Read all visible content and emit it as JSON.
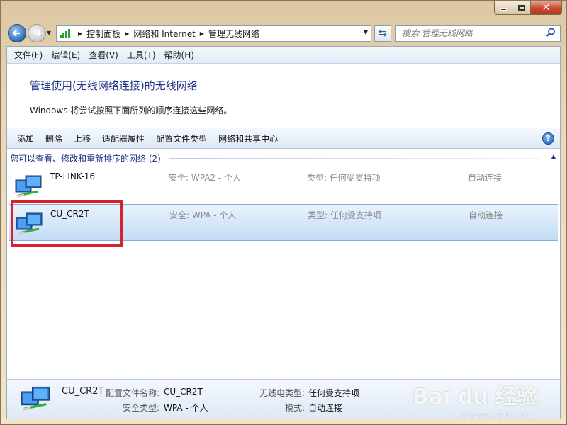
{
  "window": {
    "title": ""
  },
  "nav": {
    "breadcrumbs": [
      "控制面板",
      "网络和 Internet",
      "管理无线网络"
    ],
    "search_placeholder": "搜索 管理无线网络"
  },
  "menubar": [
    "文件(F)",
    "编辑(E)",
    "查看(V)",
    "工具(T)",
    "帮助(H)"
  ],
  "header": {
    "title": "管理使用(无线网络连接)的无线网络",
    "description": "Windows 将尝试按照下面所列的顺序连接这些网络。"
  },
  "toolbar": [
    "添加",
    "删除",
    "上移",
    "适配器属性",
    "配置文件类型",
    "网络和共享中心"
  ],
  "group": {
    "title": "您可以查看、修改和重新排序的网络 (2)"
  },
  "networks": [
    {
      "name": "TP-LINK-16",
      "security": "安全: WPA2 - 个人",
      "type": "类型: 任何受支持项",
      "mode": "自动连接",
      "selected": false
    },
    {
      "name": "CU_CR2T",
      "security": "安全: WPA - 个人",
      "type": "类型: 任何受支持项",
      "mode": "自动连接",
      "selected": true
    }
  ],
  "details": {
    "name": "CU_CR2T",
    "profile_label": "配置文件名称:",
    "profile_value": "CU_CR2T",
    "security_label": "安全类型:",
    "security_value": "WPA - 个人",
    "radio_label": "无线电类型:",
    "radio_value": "任何受支持项",
    "mode_label": "模式:",
    "mode_value": "自动连接"
  },
  "watermark": {
    "brand": "Bai du 经验",
    "url": "jingyan.baidu.com"
  },
  "colors": {
    "highlight": "#d9202b",
    "title": "#1e3287",
    "selection": "#c4dcf6"
  },
  "icons": [
    "back-arrow-icon",
    "forward-arrow-icon",
    "network-signal-icon",
    "refresh-icon",
    "search-icon",
    "help-icon",
    "wireless-network-icon"
  ]
}
